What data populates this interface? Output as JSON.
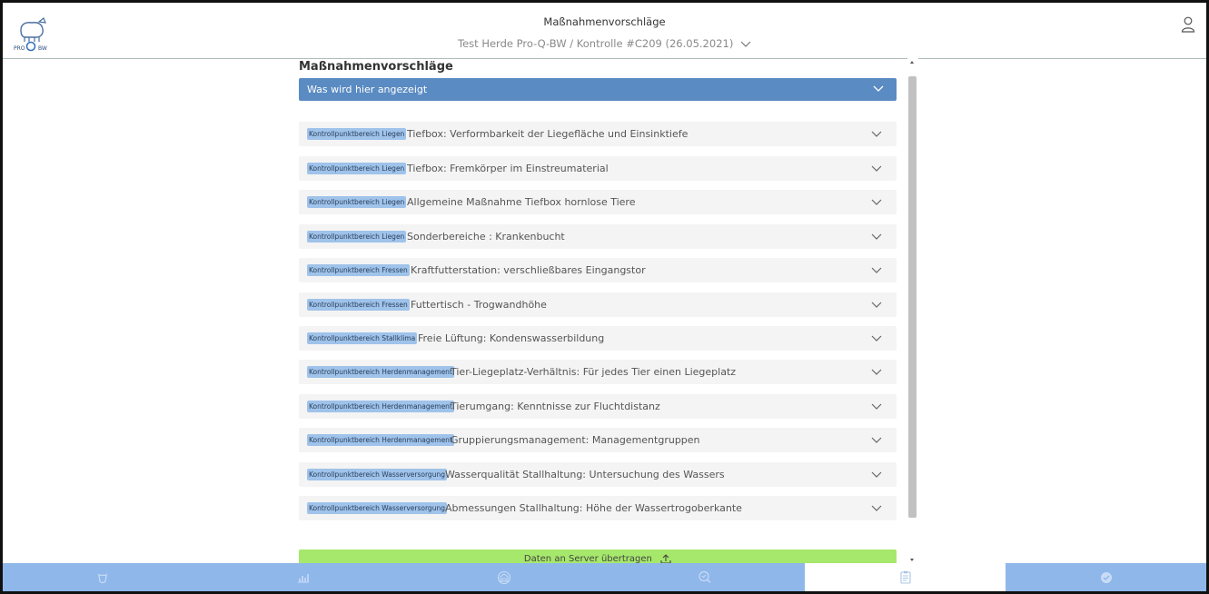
{
  "header": {
    "title": "Maßnahmenvorschläge",
    "subtitle": "Test Herde Pro-Q-BW / Kontrolle #C209 (26.05.2021)",
    "logo_icon": "pro-q-bw-cow-logo",
    "user_icon": "user-icon"
  },
  "main": {
    "title": "Maßnahmenvorschläge",
    "info_label": "Was wird hier angezeigt",
    "items": [
      {
        "tag": "Kontrollpunktbereich Liegen",
        "text": "Tiefbox: Verformbarkeit der Liegefläche und Einsinktiefe"
      },
      {
        "tag": "Kontrollpunktbereich Liegen",
        "text": "Tiefbox: Fremkörper im Einstreumaterial"
      },
      {
        "tag": "Kontrollpunktbereich Liegen",
        "text": "Allgemeine Maßnahme Tiefbox hornlose Tiere"
      },
      {
        "tag": "Kontrollpunktbereich Liegen",
        "text": "Sonderbereiche : Krankenbucht"
      },
      {
        "tag": "Kontrollpunktbereich Fressen",
        "text": "Kraftfutterstation: verschließbares Eingangstor"
      },
      {
        "tag": "Kontrollpunktbereich Fressen",
        "text": "Futtertisch - Trogwandhöhe"
      },
      {
        "tag": "Kontrollpunktbereich Stallklima",
        "text": "Freie Lüftung: Kondenswasserbildung"
      },
      {
        "tag": "Kontrollpunktbereich Herdenmanagement",
        "text": "Tier-Liegeplatz-Verhältnis: Für jedes Tier einen Liegeplatz"
      },
      {
        "tag": "Kontrollpunktbereich Herdenmanagement",
        "text": "Tierumgang: Kenntnisse zur Fluchtdistanz"
      },
      {
        "tag": "Kontrollpunktbereich Herdenmanagement",
        "text": "Gruppierungsmanagement: Managementgruppen"
      },
      {
        "tag": "Kontrollpunktbereich Wasserversorgung",
        "text": "Wasserqualität Stallhaltung: Untersuchung des Wassers"
      },
      {
        "tag": "Kontrollpunktbereich Wasserversorgung",
        "text": "Abmessungen Stallhaltung: Höhe der Wassertrogoberkante"
      }
    ],
    "send_label": "Daten an Server übertragen"
  },
  "nav": {
    "items": [
      {
        "icon": "cow-icon",
        "active": false
      },
      {
        "icon": "bar-chart-icon",
        "active": false
      },
      {
        "icon": "barn-icon",
        "active": false
      },
      {
        "icon": "magnifier-icon",
        "active": false
      },
      {
        "icon": "clipboard-icon",
        "active": true
      },
      {
        "icon": "check-circle-icon",
        "active": false
      }
    ]
  },
  "colors": {
    "accent": "#5a8bc2",
    "tag": "#9fc3ea",
    "nav": "#8fb7ea",
    "send": "#a6e86b",
    "row": "#f4f4f4"
  }
}
